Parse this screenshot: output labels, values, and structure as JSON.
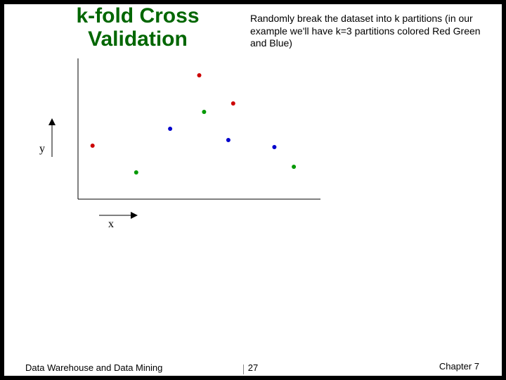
{
  "slide": {
    "title_line1": "k-fold Cross",
    "title_line2": "Validation",
    "description": "Randomly break the dataset into k partitions (in our example we'll have k=3 partitions colored Red Green and Blue)"
  },
  "axes": {
    "xlabel": "x",
    "ylabel": "y"
  },
  "footer": {
    "left": "Data Warehouse and Data Mining",
    "page": "27",
    "right": "Chapter 7"
  },
  "chart_data": {
    "type": "scatter",
    "title": "k-fold Cross Validation",
    "xlabel": "x",
    "ylabel": "y",
    "xlim": [
      0,
      10
    ],
    "ylim": [
      0,
      10
    ],
    "series": [
      {
        "name": "Red",
        "color": "#cc0000",
        "x": [
          0.6,
          5.0,
          6.4
        ],
        "y": [
          3.8,
          8.8,
          6.8
        ]
      },
      {
        "name": "Green",
        "color": "#009900",
        "x": [
          2.4,
          5.2,
          8.9
        ],
        "y": [
          1.9,
          6.2,
          2.3
        ]
      },
      {
        "name": "Blue",
        "color": "#0000cc",
        "x": [
          3.8,
          6.2,
          8.1
        ],
        "y": [
          5.0,
          4.2,
          3.7
        ]
      }
    ],
    "legend": false,
    "grid": false
  }
}
